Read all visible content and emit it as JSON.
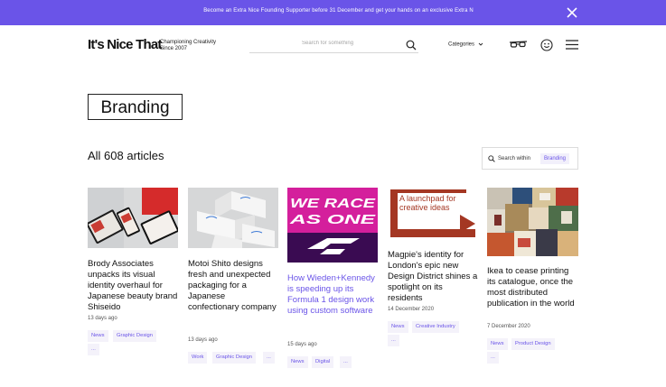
{
  "banner": {
    "text": "Become an Extra Nice Founding Supporter before 31 December and get your hands on an exclusive Extra N",
    "close_icon": "close-icon"
  },
  "header": {
    "logo": "It's Nice That",
    "tagline_line1": "Championing Creativity",
    "tagline_line2": "Since 2007",
    "search_placeholder": "Search for something",
    "categories": "Categories",
    "icons": [
      "search-icon",
      "chevron-down-icon",
      "glasses-icon",
      "smiley-icon",
      "menu-icon"
    ]
  },
  "page": {
    "title": "Branding",
    "count": "All 608 articles",
    "search_within_label": "Search within",
    "search_within_tag": "Branding"
  },
  "articles": [
    {
      "title": "Brody Associates unpacks its visual identity overhaul for Japanese beauty brand Shiseido",
      "date": "13 days ago",
      "tags": [
        "News",
        "Graphic Design",
        "..."
      ]
    },
    {
      "title": "Motoi Shito designs fresh and unexpected packaging for a Japanese confectionary company",
      "date": "13 days ago",
      "tags": [
        "Work",
        "Graphic Design",
        "..."
      ]
    },
    {
      "title": "How Wieden+Kennedy is speeding up its Formula 1 design work using custom software",
      "date": "15 days ago",
      "tags": [
        "News",
        "Digital",
        "..."
      ],
      "image_text_line1": "WE RACE",
      "image_text_line2": "AS ONE"
    },
    {
      "title": "Magpie's identity for London's epic new Design District shines a spotlight on its residents",
      "date": "14 December 2020",
      "tags": [
        "News",
        "Creative Industry",
        "..."
      ],
      "image_text_line1": "A launchpad for",
      "image_text_line2": "creative ideas"
    },
    {
      "title": "Ikea to cease printing its catalogue, once the most distributed publication in the world",
      "date": "7 December 2020",
      "tags": [
        "News",
        "Product Design",
        "..."
      ]
    }
  ],
  "colors": {
    "accent": "#6a54e8",
    "tag_bg": "#f4f2fa",
    "f1_bg": "#d41f9c"
  }
}
